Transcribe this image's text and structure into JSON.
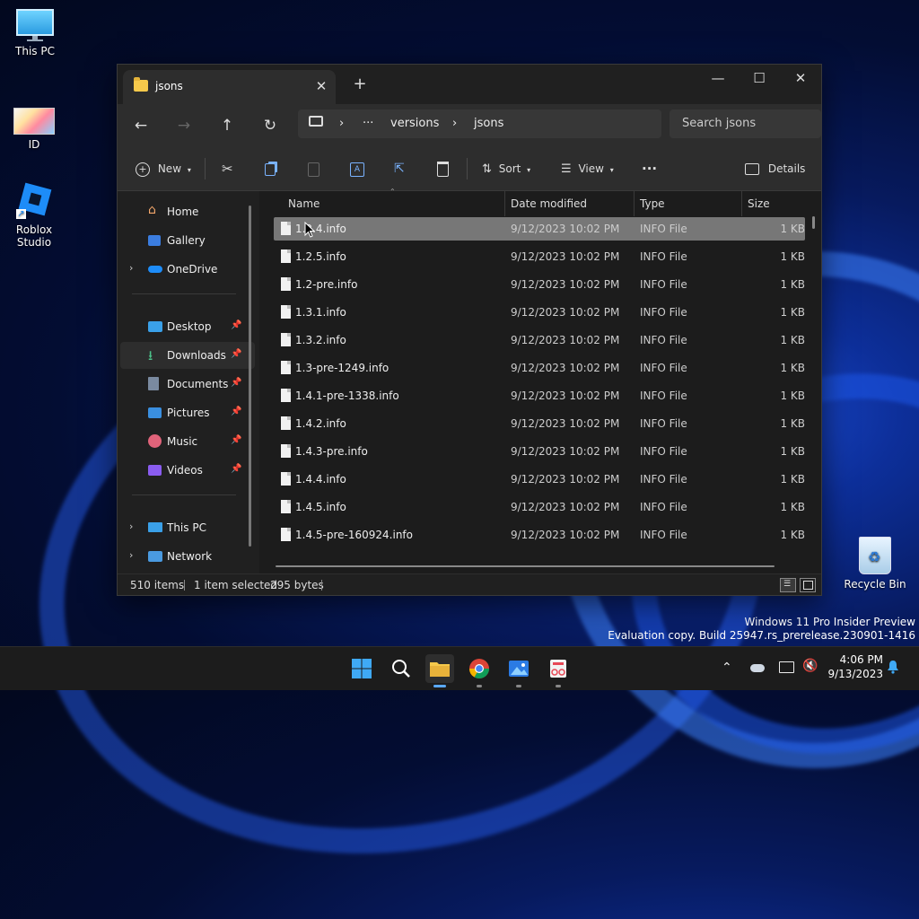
{
  "desktop": {
    "icons": [
      {
        "label": "This PC"
      },
      {
        "label": "ID"
      },
      {
        "label": "Roblox Studio"
      },
      {
        "label": "Recycle Bin"
      }
    ],
    "watermark_line1": "Windows 11 Pro Insider Preview",
    "watermark_line2": "Evaluation copy. Build 25947.rs_prerelease.230901-1416"
  },
  "window": {
    "tab_title": "jsons",
    "tab_close": "✕",
    "new_tab": "+",
    "controls": {
      "minimize": "—",
      "maximize": "☐",
      "close": "✕"
    },
    "nav": {
      "back": "←",
      "forward": "→",
      "up": "↑",
      "refresh": "↻"
    },
    "breadcrumb": {
      "more": "···",
      "items": [
        "versions",
        "jsons"
      ],
      "sep": "›"
    },
    "search_placeholder": "Search jsons",
    "toolbar": {
      "new_label": "New",
      "sort_label": "Sort",
      "view_label": "View",
      "more_label": "···",
      "details_label": "Details"
    },
    "sidebar": {
      "items": [
        {
          "label": "Home"
        },
        {
          "label": "Gallery"
        },
        {
          "label": "OneDrive"
        },
        {
          "label": "Desktop"
        },
        {
          "label": "Downloads"
        },
        {
          "label": "Documents"
        },
        {
          "label": "Pictures"
        },
        {
          "label": "Music"
        },
        {
          "label": "Videos"
        },
        {
          "label": "This PC"
        },
        {
          "label": "Network"
        }
      ]
    },
    "columns": {
      "name": "Name",
      "date": "Date modified",
      "type": "Type",
      "size": "Size"
    },
    "files": [
      {
        "name": "1.2.4.info",
        "date": "9/12/2023 10:02 PM",
        "type": "INFO File",
        "size": "1 KB"
      },
      {
        "name": "1.2.5.info",
        "date": "9/12/2023 10:02 PM",
        "type": "INFO File",
        "size": "1 KB"
      },
      {
        "name": "1.2-pre.info",
        "date": "9/12/2023 10:02 PM",
        "type": "INFO File",
        "size": "1 KB"
      },
      {
        "name": "1.3.1.info",
        "date": "9/12/2023 10:02 PM",
        "type": "INFO File",
        "size": "1 KB"
      },
      {
        "name": "1.3.2.info",
        "date": "9/12/2023 10:02 PM",
        "type": "INFO File",
        "size": "1 KB"
      },
      {
        "name": "1.3-pre-1249.info",
        "date": "9/12/2023 10:02 PM",
        "type": "INFO File",
        "size": "1 KB"
      },
      {
        "name": "1.4.1-pre-1338.info",
        "date": "9/12/2023 10:02 PM",
        "type": "INFO File",
        "size": "1 KB"
      },
      {
        "name": "1.4.2.info",
        "date": "9/12/2023 10:02 PM",
        "type": "INFO File",
        "size": "1 KB"
      },
      {
        "name": "1.4.3-pre.info",
        "date": "9/12/2023 10:02 PM",
        "type": "INFO File",
        "size": "1 KB"
      },
      {
        "name": "1.4.4.info",
        "date": "9/12/2023 10:02 PM",
        "type": "INFO File",
        "size": "1 KB"
      },
      {
        "name": "1.4.5.info",
        "date": "9/12/2023 10:02 PM",
        "type": "INFO File",
        "size": "1 KB"
      },
      {
        "name": "1.4.5-pre-160924.info",
        "date": "9/12/2023 10:02 PM",
        "type": "INFO File",
        "size": "1 KB"
      }
    ],
    "status": {
      "count": "510 items",
      "selected": "1 item selected",
      "bytes": "295 bytes"
    }
  },
  "taskbar": {
    "time": "4:06 PM",
    "date": "9/13/2023",
    "chevron": "⌃"
  },
  "colors": {
    "accent": "#0078d4",
    "folder": "#f6c94b",
    "selection": "#777777"
  }
}
